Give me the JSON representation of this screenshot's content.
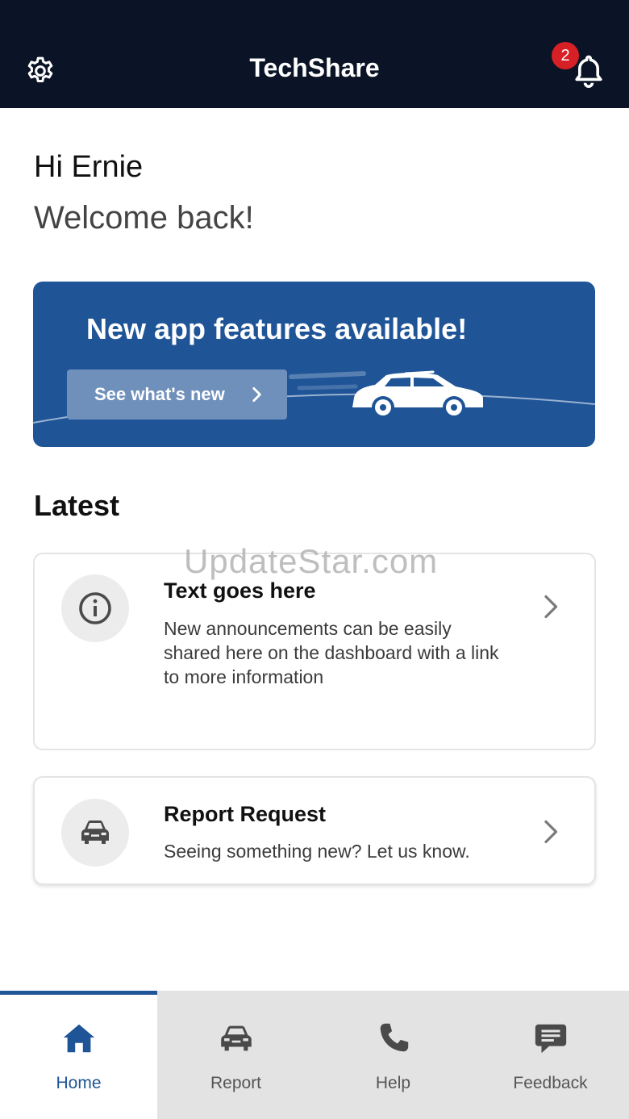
{
  "header": {
    "title": "TechShare",
    "notification_count": "2",
    "icons": [
      "gear-icon",
      "bell-icon"
    ]
  },
  "greeting": {
    "hi": "Hi Ernie",
    "welcome": "Welcome back!"
  },
  "banner": {
    "title": "New app features available!",
    "button_label": "See what's new",
    "bg_color": "#1f5497"
  },
  "latest": {
    "title": "Latest",
    "cards": [
      {
        "icon": "info-icon",
        "title": "Text goes here",
        "text": "New announcements can be easily shared here on the dashboard with a link to more information"
      },
      {
        "icon": "car-icon",
        "title": "Report Request",
        "text": "Seeing something new? Let us know."
      }
    ]
  },
  "watermark": "UpdateStar.com",
  "tabs": [
    {
      "label": "Home",
      "icon": "home-icon",
      "active": true
    },
    {
      "label": "Report",
      "icon": "car-icon",
      "active": false
    },
    {
      "label": "Help",
      "icon": "phone-icon",
      "active": false
    },
    {
      "label": "Feedback",
      "icon": "feedback-icon",
      "active": false
    }
  ],
  "colors": {
    "header_bg": "#0b1426",
    "accent": "#1f5497",
    "badge": "#d62025"
  }
}
